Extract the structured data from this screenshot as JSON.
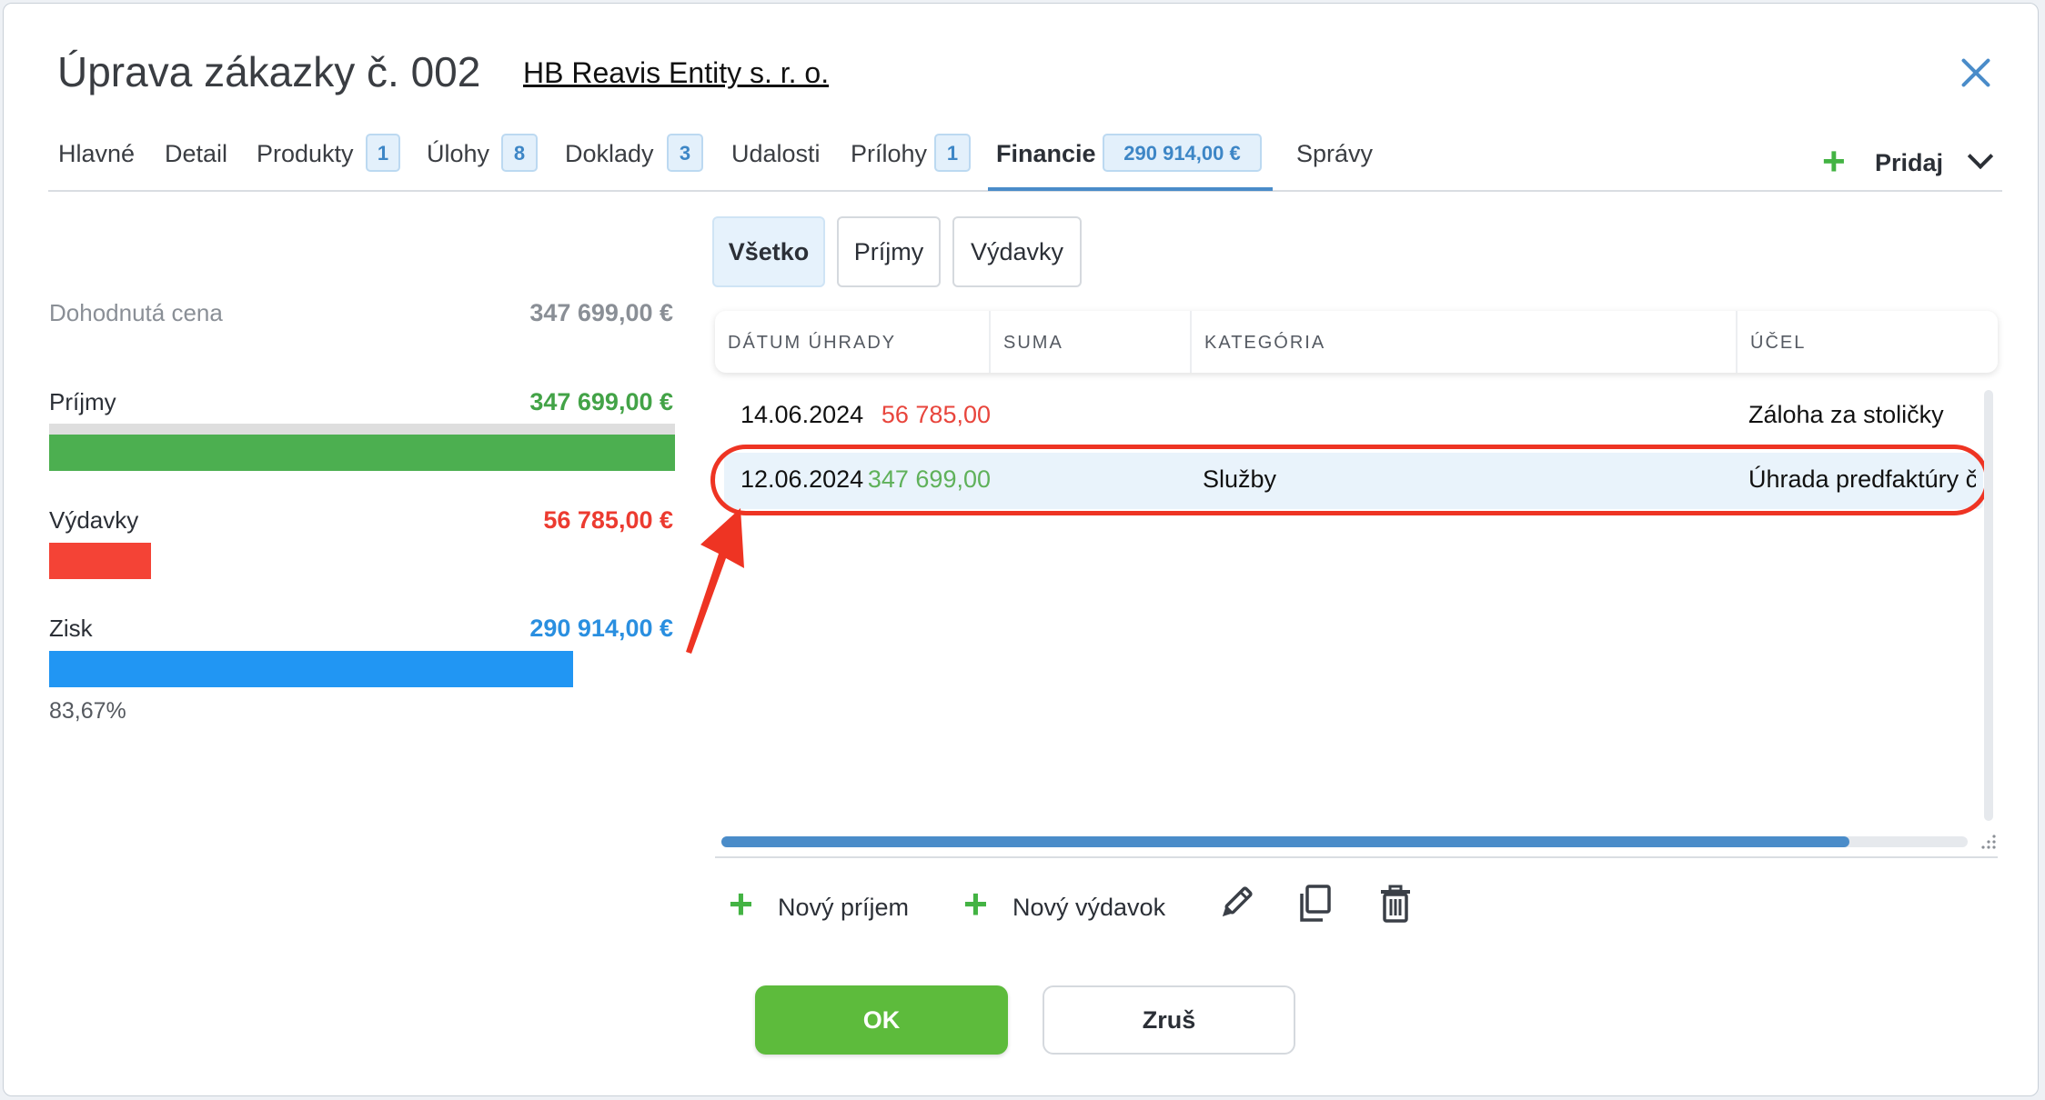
{
  "header": {
    "title": "Úprava zákazky č. 002",
    "client": "HB Reavis Entity s. r. o."
  },
  "tabs": [
    {
      "label": "Hlavné"
    },
    {
      "label": "Detail"
    },
    {
      "label": "Produkty",
      "badge": "1"
    },
    {
      "label": "Úlohy",
      "badge": "8"
    },
    {
      "label": "Doklady",
      "badge": "3"
    },
    {
      "label": "Udalosti"
    },
    {
      "label": "Prílohy",
      "badge": "1"
    },
    {
      "label": "Financie",
      "badge": "290 914,00 €",
      "active": true
    },
    {
      "label": "Správy"
    }
  ],
  "add_menu": {
    "label": "Pridaj"
  },
  "summary": {
    "agreed": {
      "label": "Dohodnutá cena",
      "value": "347 699,00 €"
    },
    "income": {
      "label": "Príjmy",
      "value": "347 699,00 €",
      "fill": 1.0,
      "color": "#4caf50"
    },
    "expense": {
      "label": "Výdavky",
      "value": "56 785,00 €",
      "fill": 0.1633,
      "color": "#f44336"
    },
    "profit": {
      "label": "Zisk",
      "value": "290 914,00 €",
      "fill": 0.8367,
      "color": "#2196f3",
      "percent": "83,67%"
    }
  },
  "filters": [
    {
      "label": "Všetko",
      "active": true
    },
    {
      "label": "Príjmy"
    },
    {
      "label": "Výdavky"
    }
  ],
  "table": {
    "columns": [
      "DÁTUM ÚHRADY",
      "SUMA",
      "KATEGÓRIA",
      "ÚČEL"
    ],
    "rows": [
      {
        "date": "14.06.2024",
        "amount": "56 785,00",
        "category": "",
        "purpose": "Záloha za stoličky",
        "amount_color": "#e8453c"
      },
      {
        "date": "12.06.2024",
        "amount": "347 699,00",
        "category": "Služby",
        "purpose": "Úhrada predfaktúry č",
        "amount_color": "#5fb15a",
        "selected": true
      }
    ]
  },
  "actions": {
    "new_income": "Nový príjem",
    "new_expense": "Nový výdavok",
    "edit_icon": "pencil-icon",
    "copy_icon": "copy-icon",
    "delete_icon": "trash-icon"
  },
  "footer": {
    "ok": "OK",
    "cancel": "Zruš"
  }
}
